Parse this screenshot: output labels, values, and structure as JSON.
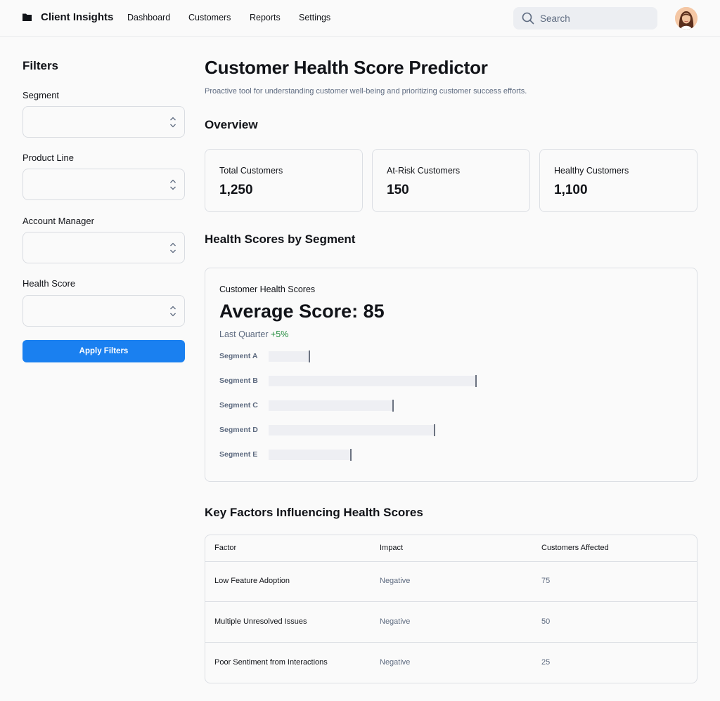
{
  "header": {
    "brand": "Client Insights",
    "nav": [
      "Dashboard",
      "Customers",
      "Reports",
      "Settings"
    ],
    "search_placeholder": "Search"
  },
  "filters": {
    "title": "Filters",
    "fields": [
      {
        "label": "Segment",
        "value": ""
      },
      {
        "label": "Product Line",
        "value": ""
      },
      {
        "label": "Account Manager",
        "value": ""
      },
      {
        "label": "Health Score",
        "value": ""
      }
    ],
    "apply_label": "Apply Filters"
  },
  "main": {
    "title": "Customer Health Score Predictor",
    "subtitle": "Proactive tool for understanding customer well-being and prioritizing customer success efforts.",
    "overview_heading": "Overview",
    "cards": [
      {
        "label": "Total Customers",
        "value": "1,250"
      },
      {
        "label": "At-Risk Customers",
        "value": "150"
      },
      {
        "label": "Healthy Customers",
        "value": "1,100"
      }
    ],
    "segment_heading": "Health Scores by Segment",
    "segment_panel": {
      "title": "Customer Health Scores",
      "big_value": "Average Score: 85",
      "period": "Last Quarter",
      "change": "+5%"
    },
    "factors_heading": "Key Factors Influencing Health Scores",
    "table": {
      "headers": [
        "Factor",
        "Impact",
        "Customers Affected"
      ],
      "rows": [
        [
          "Low Feature Adoption",
          "Negative",
          "75"
        ],
        [
          "Multiple Unresolved Issues",
          "Negative",
          "50"
        ],
        [
          "Poor Sentiment from Interactions",
          "Negative",
          "25"
        ]
      ]
    }
  },
  "chart_data": {
    "type": "bar",
    "categories": [
      "Segment A",
      "Segment B",
      "Segment C",
      "Segment D",
      "Segment E"
    ],
    "values": [
      0.2,
      1.0,
      0.6,
      0.8,
      0.4
    ],
    "value_scale": "fraction of longest bar",
    "xlabel": "",
    "ylabel": ""
  },
  "colors": {
    "accent": "#1a80f0",
    "positive": "#1f8a3b",
    "muted_text": "#5e6b80",
    "bar_fill": "#eeeff3"
  },
  "icons": {
    "brand": "folder-icon",
    "search": "search-icon",
    "select": "chevron-up-down-icon"
  }
}
